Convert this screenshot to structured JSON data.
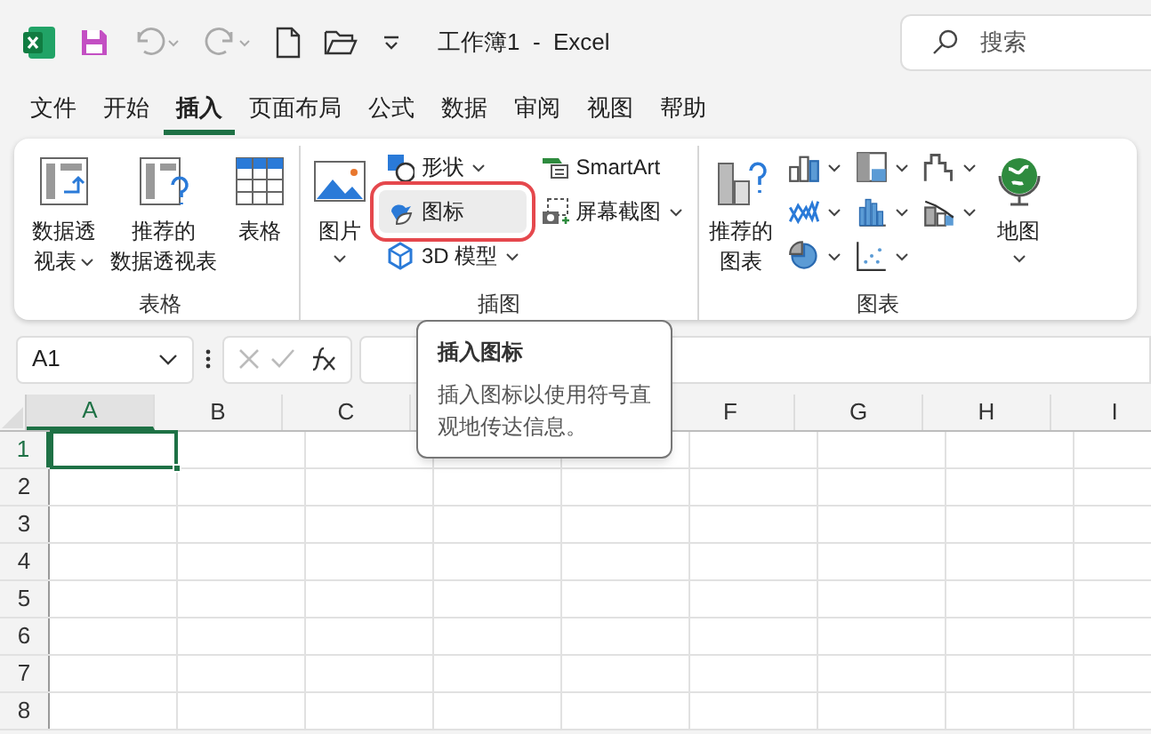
{
  "title_bar": {
    "title": "工作簿1  -  Excel",
    "search": {
      "placeholder": "搜索"
    }
  },
  "menu_tabs": [
    {
      "label": "文件",
      "selected": false
    },
    {
      "label": "开始",
      "selected": false
    },
    {
      "label": "插入",
      "selected": true
    },
    {
      "label": "页面布局",
      "selected": false
    },
    {
      "label": "公式",
      "selected": false
    },
    {
      "label": "数据",
      "selected": false
    },
    {
      "label": "审阅",
      "selected": false
    },
    {
      "label": "视图",
      "selected": false
    },
    {
      "label": "帮助",
      "selected": false
    }
  ],
  "ribbon": {
    "groups": [
      {
        "label": "表格",
        "items": [
          {
            "kind": "large",
            "lines": [
              "数据透",
              "视表"
            ],
            "dropdown": true
          },
          {
            "kind": "large",
            "lines": [
              "推荐的",
              "数据透视表"
            ],
            "dropdown": false
          },
          {
            "kind": "large",
            "lines": [
              "表格"
            ],
            "dropdown": false
          }
        ]
      },
      {
        "label": "插图",
        "items": [
          {
            "kind": "large",
            "lines": [
              "图片"
            ],
            "dropdown": true
          },
          {
            "kind": "small",
            "label": "形状",
            "dropdown": true,
            "highlighted": false
          },
          {
            "kind": "small",
            "label": "图标",
            "dropdown": false,
            "highlighted": true
          },
          {
            "kind": "small",
            "label": "3D 模型",
            "dropdown": true,
            "highlighted": false
          },
          {
            "kind": "small",
            "label": "SmartArt",
            "dropdown": false,
            "highlighted": false
          },
          {
            "kind": "small",
            "label": "屏幕截图",
            "dropdown": true,
            "highlighted": false
          }
        ]
      },
      {
        "label": "图表",
        "items": [
          {
            "kind": "large",
            "lines": [
              "推荐的",
              "图表"
            ],
            "dropdown": false
          },
          {
            "kind": "icon",
            "dropdown": true
          },
          {
            "kind": "icon",
            "dropdown": true
          },
          {
            "kind": "icon",
            "dropdown": true
          },
          {
            "kind": "icon",
            "dropdown": true
          },
          {
            "kind": "icon",
            "dropdown": true
          },
          {
            "kind": "icon",
            "dropdown": true
          },
          {
            "kind": "icon",
            "dropdown": true
          },
          {
            "kind": "icon",
            "dropdown": true
          },
          {
            "kind": "large",
            "lines": [
              "地图"
            ],
            "dropdown": true
          }
        ]
      }
    ]
  },
  "formula_bar": {
    "name_box": "A1"
  },
  "grid": {
    "columns": [
      {
        "label": "A",
        "selected": true
      },
      {
        "label": "B",
        "selected": false
      },
      {
        "label": "C",
        "selected": false
      },
      {
        "label": "F",
        "selected": false
      },
      {
        "label": "G",
        "selected": false
      },
      {
        "label": "H",
        "selected": false
      },
      {
        "label": "I",
        "selected": false
      }
    ],
    "rows": [
      {
        "label": "1",
        "selected": true
      },
      {
        "label": "2",
        "selected": false
      },
      {
        "label": "3",
        "selected": false
      },
      {
        "label": "4",
        "selected": false
      },
      {
        "label": "5",
        "selected": false
      },
      {
        "label": "6",
        "selected": false
      },
      {
        "label": "7",
        "selected": false
      },
      {
        "label": "8",
        "selected": false
      }
    ]
  },
  "tooltip": {
    "title": "插入图标",
    "text": "插入图标以使用符号直观地传达信息。"
  }
}
